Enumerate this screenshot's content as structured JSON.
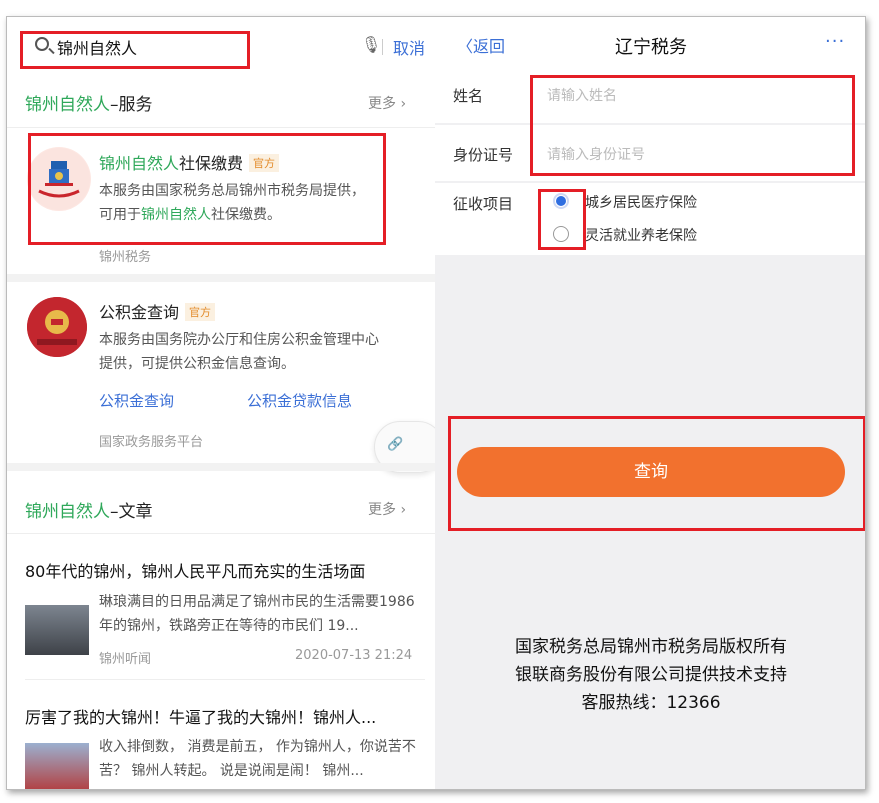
{
  "left": {
    "search": {
      "query": "锦州自然人",
      "cancel": "取消"
    },
    "service_section": {
      "keyword": "锦州自然人",
      "suffix": "–服务",
      "more": "更多 ›"
    },
    "services": [
      {
        "title_kw": "锦州自然人",
        "title_rest": "社保缴费",
        "tag": "官方",
        "desc_a": "本服务由国家税务总局锦州市税务局提供，可用于",
        "desc_kw": "锦州自然人",
        "desc_b": "社保缴费。",
        "source": "锦州税务"
      },
      {
        "title": "公积金查询",
        "tag": "官方",
        "desc": "本服务由国务院办公厅和住房公积金管理中心提供，可提供公积金信息查询。",
        "links": [
          "公积金查询",
          "公积金贷款信息"
        ],
        "source": "国家政务服务平台"
      }
    ],
    "article_section": {
      "keyword": "锦州自然人",
      "suffix": "–文章",
      "more": "更多 ›"
    },
    "articles": [
      {
        "title": "80年代的锦州，锦州人民平凡而充实的生活场面",
        "snippet": "琳琅满目的日用品满足了锦州市民的生活需要1986年的锦州，铁路旁正在等待的市民们 19...",
        "source": "锦州听闻",
        "time": "2020-07-13 21:24"
      },
      {
        "title": "厉害了我的大锦州！牛逼了我的大锦州！锦州人...",
        "snippet": "收入排倒数， 消费是前五， 作为锦州人，你说苦不苦？ 锦州人转起。 说是说闹是闹！ 锦州..."
      }
    ]
  },
  "right": {
    "nav": {
      "back": "返回",
      "title": "辽宁税务",
      "menu": "···"
    },
    "form": {
      "name_label": "姓名",
      "name_placeholder": "请输入姓名",
      "id_label": "身份证号",
      "id_placeholder": "请输入身份证号",
      "item_label": "征收项目",
      "options": [
        "城乡居民医疗保险",
        "灵活就业养老保险"
      ],
      "selected_index": 0
    },
    "query_button": "查询",
    "footer": [
      "国家税务总局锦州市税务局版权所有",
      "银联商务股份有限公司提供技术支持",
      "客服热线：12366"
    ]
  },
  "colors": {
    "accent_blue": "#3b6fd6",
    "keyword_green": "#2fa85a",
    "button_orange": "#f2712e",
    "highlight_red": "#e41e26",
    "tag_orange": "#e38b2a"
  }
}
